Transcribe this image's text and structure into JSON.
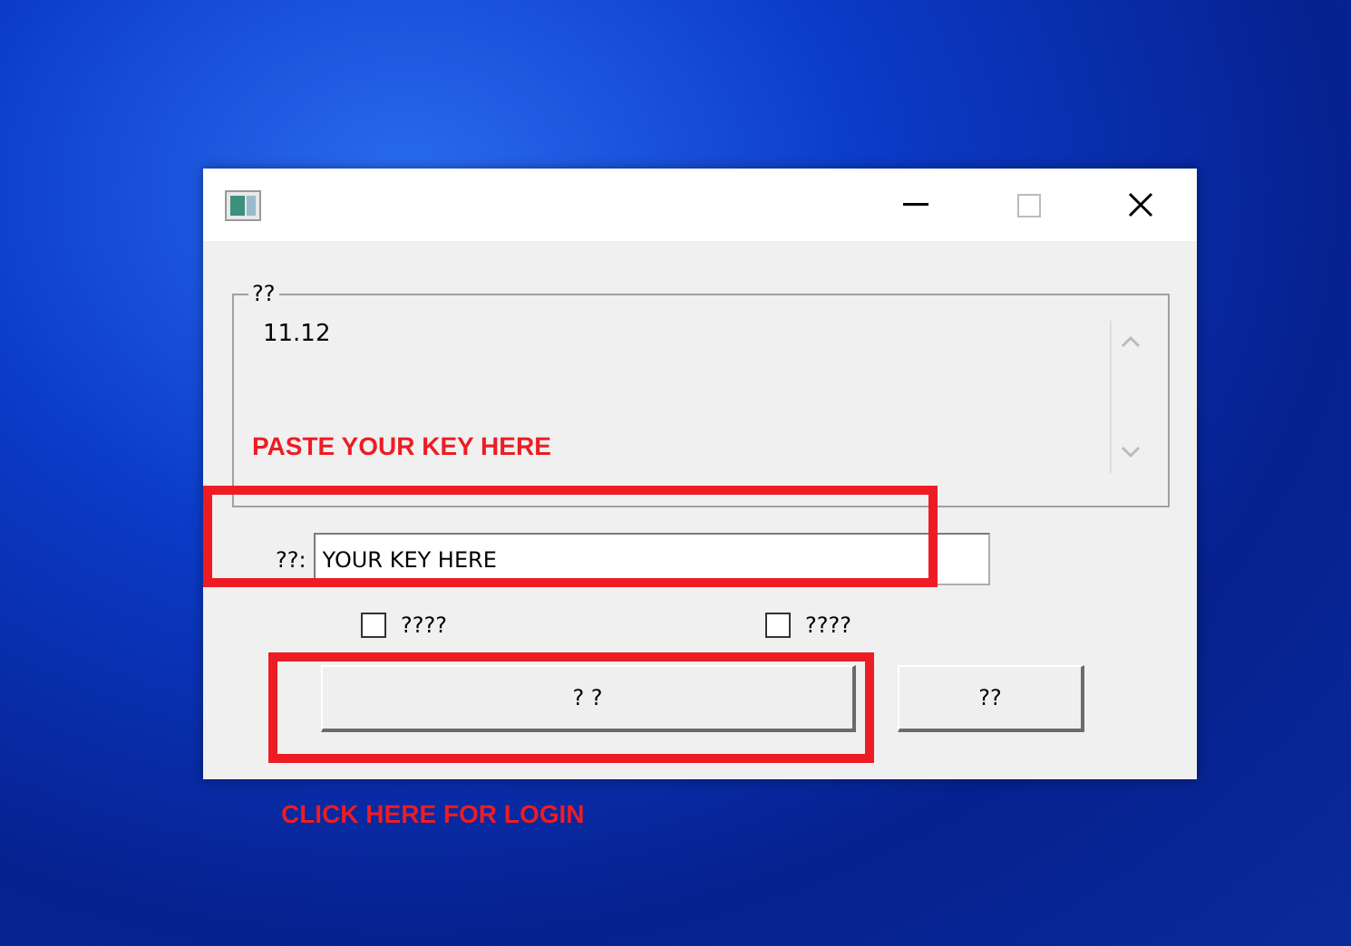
{
  "group": {
    "title": "??",
    "text": "11.12"
  },
  "key_field": {
    "label": "??:",
    "value": "YOUR KEY HERE"
  },
  "checkboxes": [
    {
      "label": "????",
      "checked": false
    },
    {
      "label": "????",
      "checked": false
    }
  ],
  "buttons": [
    "? ?",
    "??"
  ],
  "annotations": [
    "PASTE YOUR KEY HERE",
    "CLICK HERE FOR LOGIN"
  ]
}
